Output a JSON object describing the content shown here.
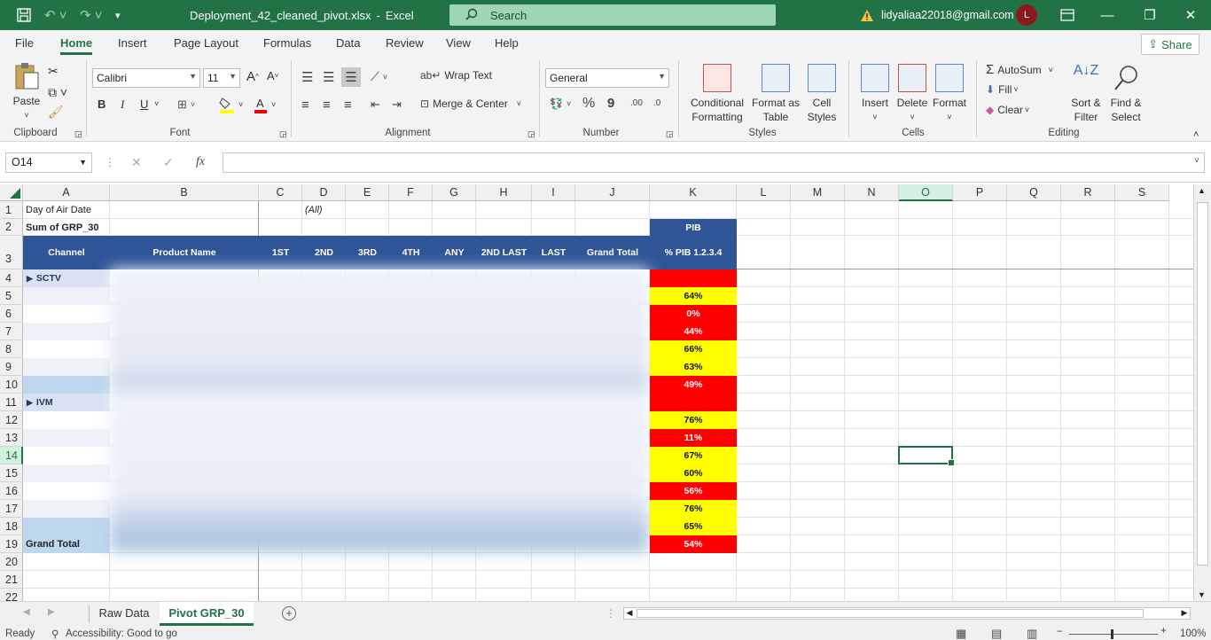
{
  "window": {
    "filename": "Deployment_42_cleaned_pivot.xlsx",
    "separator": "-",
    "app": "Excel",
    "search_placeholder": "Search",
    "user_email": "lidyaliaa22018@gmail.com",
    "avatar_initial": "L",
    "minimize": "—",
    "restore": "❐",
    "close": "✕"
  },
  "menu": {
    "items": [
      "File",
      "Home",
      "Insert",
      "Page Layout",
      "Formulas",
      "Data",
      "Review",
      "View",
      "Help"
    ],
    "active": "Home",
    "share": "Share"
  },
  "ribbon": {
    "clipboard": {
      "paste": "Paste",
      "label": "Clipboard"
    },
    "font": {
      "name": "Calibri",
      "size": "11",
      "label": "Font",
      "bold": "B",
      "italic": "I",
      "underline": "U"
    },
    "alignment": {
      "wrap": "Wrap Text",
      "merge": "Merge & Center",
      "label": "Alignment"
    },
    "number": {
      "format": "General",
      "label": "Number",
      "percent": "%",
      "comma": "9",
      "inc_dec": ".00",
      "dec_dec": ".0"
    },
    "styles": {
      "conditional": [
        "Conditional",
        "Formatting"
      ],
      "format_table": [
        "Format as",
        "Table"
      ],
      "cell_styles": [
        "Cell",
        "Styles"
      ],
      "label": "Styles"
    },
    "cells": {
      "insert": "Insert",
      "delete": "Delete",
      "format": "Format",
      "label": "Cells"
    },
    "editing": {
      "autosum": "AutoSum",
      "fill": "Fill",
      "clear": "Clear",
      "sort": [
        "Sort &",
        "Filter"
      ],
      "find": [
        "Find &",
        "Select"
      ],
      "label": "Editing"
    }
  },
  "formula_bar": {
    "name_box": "O14",
    "fx": "fx",
    "value": ""
  },
  "columns": [
    "A",
    "B",
    "C",
    "D",
    "E",
    "F",
    "G",
    "H",
    "I",
    "J",
    "K",
    "L",
    "M",
    "N",
    "O",
    "P",
    "Q",
    "R",
    "S"
  ],
  "rows": [
    "1",
    "2",
    "3",
    "4",
    "5",
    "6",
    "7",
    "8",
    "9",
    "10",
    "11",
    "12",
    "13",
    "14",
    "15",
    "16",
    "17",
    "18",
    "19",
    "20",
    "21",
    "22"
  ],
  "selected": {
    "col": "O",
    "row": "14"
  },
  "pivot": {
    "filter_label": "Day of Air Date",
    "filter_value": "(All)",
    "value_label": "Sum of GRP_30",
    "pib_header": "PIB",
    "headers": [
      "Channel",
      "Product Name",
      "1ST",
      "2ND",
      "3RD",
      "4TH",
      "ANY",
      "2ND LAST",
      "LAST",
      "Grand Total",
      "% PIB 1.2.3.4"
    ],
    "groups": [
      {
        "name": "SCTV",
        "expand_icon": "▶",
        "row": 4
      },
      {
        "name": "IVM",
        "expand_icon": "▶",
        "row": 11
      }
    ],
    "grand_total": "Grand Total",
    "pib_values": [
      {
        "row": 4,
        "text": "",
        "color": "red"
      },
      {
        "row": 5,
        "text": "64%",
        "color": "yellow"
      },
      {
        "row": 6,
        "text": "0%",
        "color": "red"
      },
      {
        "row": 7,
        "text": "44%",
        "color": "red"
      },
      {
        "row": 8,
        "text": "66%",
        "color": "yellow"
      },
      {
        "row": 9,
        "text": "63%",
        "color": "yellow"
      },
      {
        "row": 10,
        "text": "49%",
        "color": "red"
      },
      {
        "row": 11,
        "text": "",
        "color": "red"
      },
      {
        "row": 12,
        "text": "76%",
        "color": "yellow"
      },
      {
        "row": 13,
        "text": "11%",
        "color": "red"
      },
      {
        "row": 14,
        "text": "67%",
        "color": "yellow"
      },
      {
        "row": 15,
        "text": "60%",
        "color": "yellow"
      },
      {
        "row": 16,
        "text": "56%",
        "color": "red"
      },
      {
        "row": 17,
        "text": "76%",
        "color": "yellow"
      },
      {
        "row": 18,
        "text": "65%",
        "color": "yellow"
      },
      {
        "row": 19,
        "text": "54%",
        "color": "red"
      }
    ]
  },
  "sheets": {
    "tabs": [
      "Raw Data",
      "Pivot GRP_30"
    ],
    "active": "Pivot GRP_30",
    "add": "+"
  },
  "status": {
    "ready": "Ready",
    "accessibility": "Accessibility: Good to go",
    "zoom": "100%"
  },
  "colors": {
    "excel_green": "#217346",
    "header_blue": "#2f5597",
    "red": "#ff0000",
    "yellow": "#ffff00"
  }
}
